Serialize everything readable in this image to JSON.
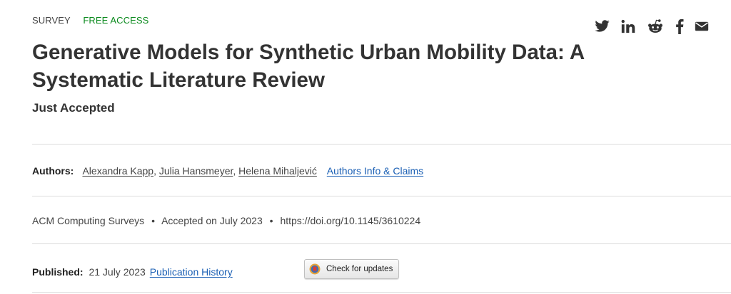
{
  "header": {
    "type_label": "SURVEY",
    "access_label": "FREE ACCESS",
    "access_color": "#0b8a1e"
  },
  "share": {
    "icons": [
      "twitter-icon",
      "linkedin-icon",
      "reddit-icon",
      "facebook-icon",
      "email-icon"
    ]
  },
  "article": {
    "title": "Generative Models for Synthetic Urban Mobility Data: A Systematic Literature Review",
    "status": "Just Accepted"
  },
  "authors": {
    "label": "Authors:",
    "names": [
      "Alexandra Kapp",
      "Julia Hansmeyer",
      "Helena Mihaljević"
    ],
    "separator": ",",
    "info_link": "Authors Info & Claims"
  },
  "citation": {
    "journal": "ACM Computing Surveys",
    "bullet": "•",
    "accepted": "Accepted on July 2023",
    "doi": "https://doi.org/10.1145/3610224"
  },
  "published": {
    "label": "Published:",
    "date": "21 July 2023",
    "history_link": "Publication History",
    "check_updates": "Check for updates"
  },
  "colors": {
    "link": "#1a5fb4",
    "divider": "#dcdcdc",
    "icon": "#333333"
  }
}
